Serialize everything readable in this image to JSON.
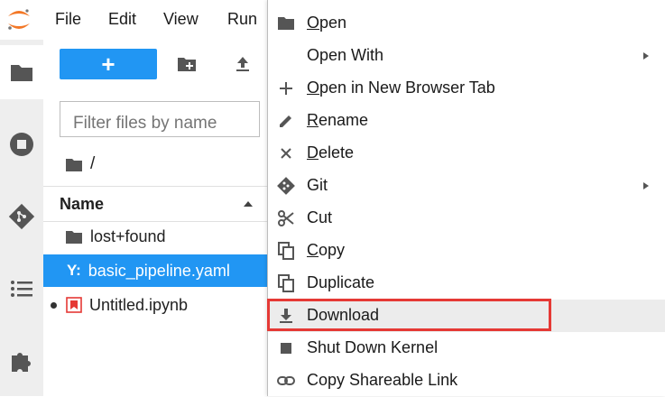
{
  "menubar": {
    "items": [
      {
        "label": "File"
      },
      {
        "label": "Edit"
      },
      {
        "label": "View"
      },
      {
        "label": "Run"
      }
    ]
  },
  "sidebar": {
    "tabs": [
      {
        "icon": "folder-icon",
        "active": true
      },
      {
        "icon": "stop-circle-icon"
      },
      {
        "icon": "git-icon"
      },
      {
        "icon": "list-icon"
      },
      {
        "icon": "puzzle-icon"
      }
    ]
  },
  "filebrowser": {
    "new_label": "+",
    "filter_placeholder": "Filter files by name",
    "breadcrumb": "/",
    "column_name": "Name",
    "files": [
      {
        "name": "lost+found",
        "icon": "folder-icon",
        "selected": false,
        "running": false
      },
      {
        "name": "basic_pipeline.yaml",
        "icon_text": "Y:",
        "selected": true,
        "running": false
      },
      {
        "name": "Untitled.ipynb",
        "icon": "notebook-icon",
        "selected": false,
        "running": true
      }
    ]
  },
  "context_menu": {
    "items": [
      {
        "label": "Open",
        "underline": "O",
        "rest": "pen",
        "icon": "folder-icon"
      },
      {
        "label": "Open With",
        "icon": "",
        "submenu": true
      },
      {
        "label": "Open in New Browser Tab",
        "underline": "O",
        "rest": "pen in New Browser Tab",
        "icon": "plus-icon"
      },
      {
        "label": "Rename",
        "underline": "R",
        "rest": "ename",
        "icon": "pencil-icon"
      },
      {
        "label": "Delete",
        "underline": "D",
        "rest": "elete",
        "icon": "close-icon"
      },
      {
        "label": "Git",
        "icon": "git-icon",
        "submenu": true
      },
      {
        "label": "Cut",
        "icon": "scissors-icon"
      },
      {
        "label": "Copy",
        "underline": "C",
        "rest": "opy",
        "icon": "copy-icon"
      },
      {
        "label": "Duplicate",
        "icon": "copy-icon"
      },
      {
        "label": "Download",
        "icon": "download-icon",
        "active": true
      },
      {
        "label": "Shut Down Kernel",
        "icon": "stop-square-icon"
      },
      {
        "label": "Copy Shareable Link",
        "icon": "link-icon"
      }
    ]
  },
  "colors": {
    "accent": "#2196f3",
    "highlight_border": "#e53935",
    "logo": "#f37726"
  }
}
